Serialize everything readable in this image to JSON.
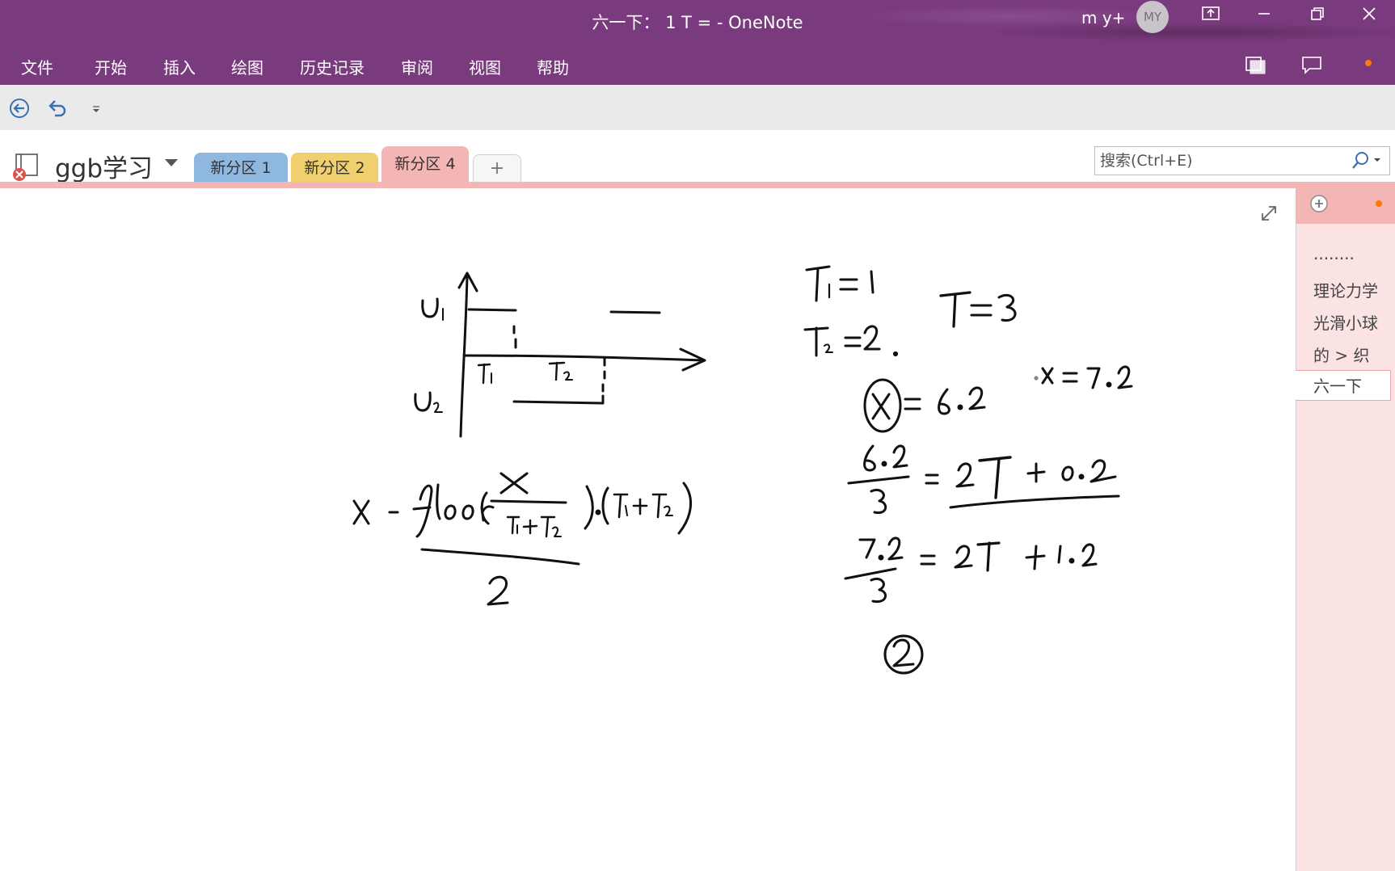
{
  "window": {
    "title": "六一下：  1 T =  -  OneNote",
    "user_name": "m y+",
    "avatar_initials": "MY"
  },
  "menu": {
    "items": [
      "文件",
      "开始",
      "插入",
      "绘图",
      "历史记录",
      "审阅",
      "视图",
      "帮助"
    ]
  },
  "notebook": {
    "name": "ggb学习",
    "sections": [
      {
        "label": "新分区 1",
        "color": "#8fb8e0"
      },
      {
        "label": "新分区 2",
        "color": "#f0cf6e"
      },
      {
        "label": "新分区 4",
        "color": "#f3b6b4"
      }
    ],
    "add_section_label": "+"
  },
  "search": {
    "placeholder": "搜索(Ctrl+E)"
  },
  "pages": {
    "items": [
      "........",
      "理论力学",
      "光滑小球",
      "的 >  织",
      "六一下"
    ],
    "selected": "六一下"
  },
  "colors": {
    "title_bar": "#7a3a7e",
    "active_section": "#f3b6b4",
    "page_pane": "#fae3e2",
    "notification_dot": "#ff7a00"
  },
  "ink_text": {
    "u1": "U1",
    "u2": "U2",
    "t1": "T1",
    "t2": "T2",
    "eq_t1": "T1 = 1",
    "eq_t2": "T2 = 2",
    "eq_T": "T = 3",
    "eq_x": "x = 6.2",
    "eq_x2": "x = 7.2",
    "frac1": "6.2 / 3 = 2T + 0.2",
    "frac2": "7.2 / 3 = 2T + 1.2",
    "formula": "x - floor(x / (T1+T2)) · (T1+T2)",
    "formula_den": "2",
    "circled": "2"
  }
}
